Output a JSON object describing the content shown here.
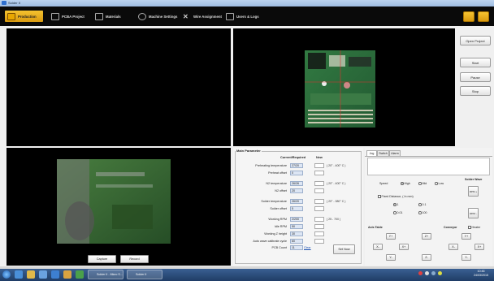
{
  "window": {
    "title": "Solder II"
  },
  "tabs": [
    {
      "label": "Production",
      "icon": "production-icon"
    },
    {
      "label": "PCBA Project",
      "icon": "pcba-icon"
    },
    {
      "label": "Materials",
      "icon": "materials-icon"
    },
    {
      "label": "Machine Settings",
      "icon": "gear-icon"
    },
    {
      "label": "Wire Assignment",
      "icon": "wire-icon"
    },
    {
      "label": "Users & Logs",
      "icon": "users-icon"
    }
  ],
  "sidebar": {
    "open_project": "Open Project",
    "start": "Start",
    "pause": "Pause",
    "stop": "Stop"
  },
  "camera": {
    "capture": "Capture",
    "record": "Record"
  },
  "main_parameter": {
    "title": "Main Parameter",
    "col_current": "Current/Required",
    "col_new": "New",
    "rows": [
      {
        "label": "Preheating temperature",
        "value": "27/20",
        "range": "( 20° - 400° C )"
      },
      {
        "label": "Preheat offset",
        "value": "0",
        "range": ""
      },
      {
        "label": "N2 temperature",
        "value": "26/26",
        "range": "( 20° - 400° C )"
      },
      {
        "label": "N2 offset",
        "value": "20",
        "range": ""
      },
      {
        "label": "Solder temperature",
        "value": "26/20",
        "range": "( 20° - 380° C )"
      },
      {
        "label": "Solder offset",
        "value": "5",
        "range": ""
      },
      {
        "label": "Working RPM",
        "value": "2/200",
        "range": "( 25 - 700 )"
      },
      {
        "label": "Idle RPM",
        "value": "50",
        "range": ""
      },
      {
        "label": "Working Z height",
        "value": "30",
        "range": ""
      },
      {
        "label": "Auto wave calibrate cycle",
        "value": "60",
        "range": ""
      },
      {
        "label": "PCB Count",
        "value": "11",
        "range": ""
      }
    ],
    "clear_label": "Clear",
    "set_now_label": "Set Now"
  },
  "right_panel": {
    "tabs": [
      "Jog",
      "Switch",
      "Alarm"
    ],
    "solder_wave": "Solder Wave",
    "rpm_up": "RPM +",
    "rpm_down": "RPM -",
    "speed_label": "Speed",
    "speed_high": "High",
    "speed_mid": "Mid",
    "speed_low": "Low",
    "fixed_distance": "Fixed Distance, ( In mm)",
    "dist_1": "1",
    "dist_01": "0.1",
    "dist_001": "0.01",
    "dist_100": "100",
    "axis_table": "Axis Table",
    "conveyor": "Conveyor",
    "heater": "Heater",
    "y_plus": "Y+",
    "y_minus": "Y-",
    "x_plus": "X+",
    "x_minus": "X-",
    "z_plus": "Z+",
    "z_minus": "Z-"
  },
  "taskbar": {
    "win1": "Solder II - Micro S...",
    "win2": "Solder II",
    "clock_time": "10:46",
    "clock_date": "24/03/2015"
  },
  "colors": {
    "accent": "#e0a517",
    "titlebar": "#a9c5e8",
    "taskbar": "#264a78"
  }
}
